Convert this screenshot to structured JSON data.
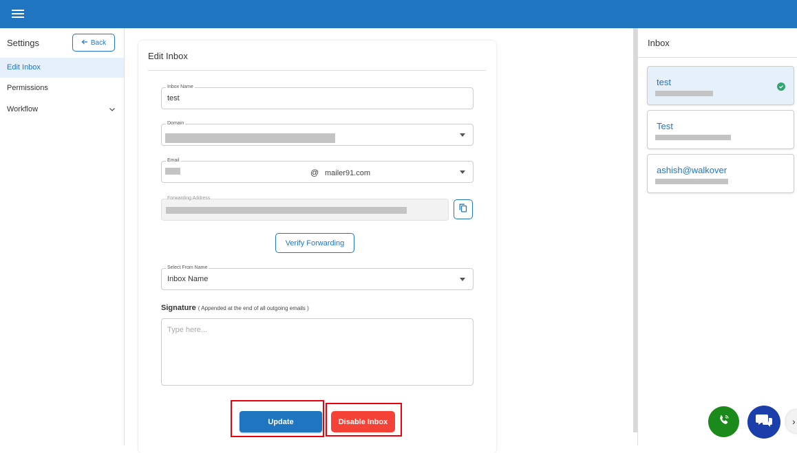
{
  "topbar": {
    "menu_icon": "hamburger-menu-icon",
    "color": "#1f75c0"
  },
  "sidebar": {
    "title": "Settings",
    "back_label": "Back",
    "items": [
      {
        "label": "Edit Inbox",
        "active": true
      },
      {
        "label": "Permissions",
        "active": false
      },
      {
        "label": "Workflow",
        "active": false,
        "expandable": true
      }
    ]
  },
  "edit_inbox": {
    "title": "Edit Inbox",
    "inbox_name": {
      "label": "Inbox Name",
      "value": "test"
    },
    "domain": {
      "label": "Domain"
    },
    "email": {
      "label": "Email",
      "at": "@",
      "domain": "mailer91.com"
    },
    "forwarding_address": {
      "label": "Forwarding Address"
    },
    "verify_label": "Verify Forwarding",
    "from_name": {
      "label": "Select From Name",
      "value": "Inbox Name"
    },
    "signature": {
      "label": "Signature",
      "note": "( Appended at the end of all outgoing emails )",
      "placeholder": "Type here..."
    },
    "update_label": "Update",
    "disable_label": "Disable Inbox"
  },
  "inbox_panel": {
    "title": "Inbox",
    "inboxes": [
      {
        "name": "test",
        "selected": true
      },
      {
        "name": "Test",
        "selected": false
      },
      {
        "name": "ashish@walkover",
        "selected": false
      }
    ]
  },
  "colors": {
    "primary": "#1f75c0",
    "danger": "#f44336",
    "success": "#2ea66f",
    "phone_fab": "#1a8a1a",
    "chat_fab": "#1b3faa"
  }
}
